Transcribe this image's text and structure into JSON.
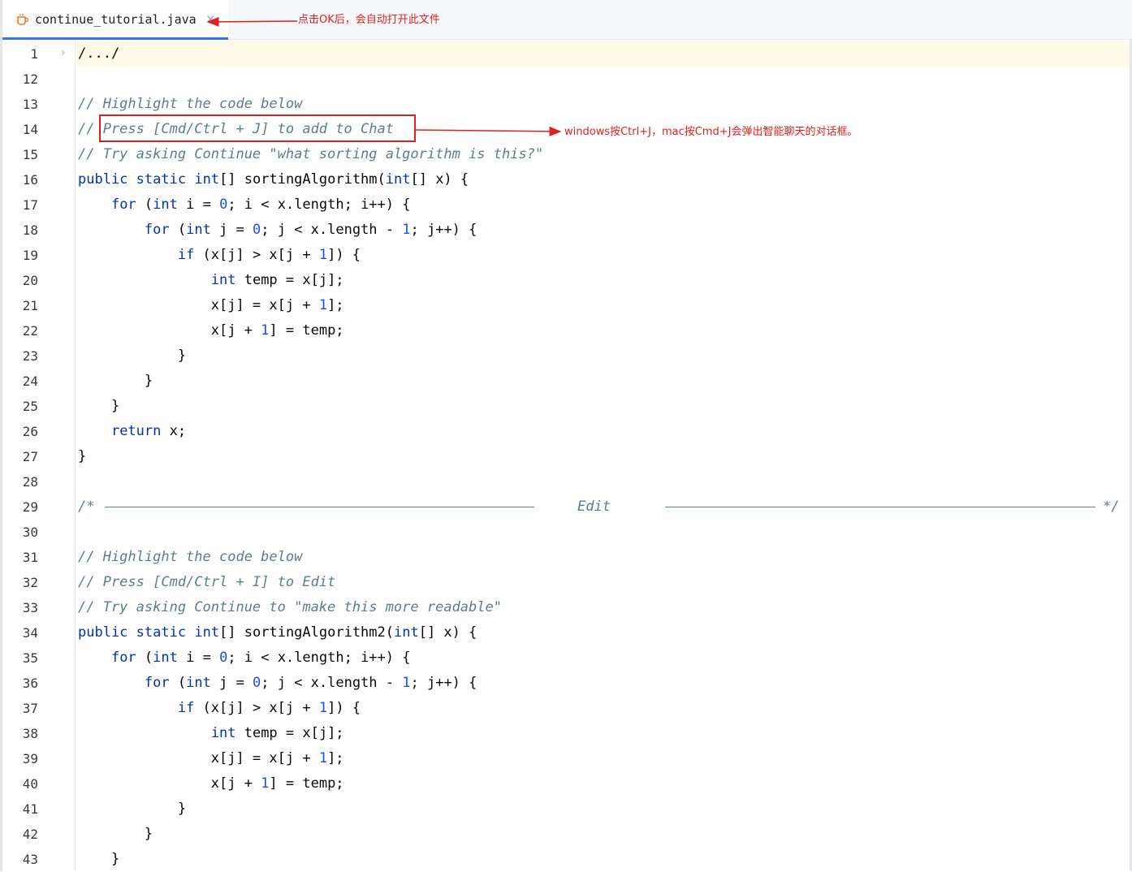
{
  "tab": {
    "file_name": "continue_tutorial.java",
    "icon": "java-file-icon",
    "close_glyph": "×"
  },
  "annotations": {
    "tab_note": "点击OK后，会自动打开此文件",
    "chat_note": "windows按Ctrl+J，mac按Cmd+J会弹出智能聊天的对话框。"
  },
  "colors": {
    "accent": "#3574f0",
    "annotation_red": "#e02020",
    "comment": "#5a7f87",
    "keyword": "#0033b3",
    "number": "#1750eb"
  },
  "editor": {
    "lines": [
      {
        "n": "1",
        "fold": "›",
        "text": "/.../",
        "kind": "folded"
      },
      {
        "n": "12",
        "text": ""
      },
      {
        "n": "13",
        "text": "// Highlight the code below",
        "kind": "comment"
      },
      {
        "n": "14",
        "text": "// Press [Cmd/Ctrl + J] to add to Chat",
        "kind": "comment"
      },
      {
        "n": "15",
        "text": "// Try asking Continue \"what sorting algorithm is this?\"",
        "kind": "comment"
      },
      {
        "n": "16",
        "text": "public static int[] sortingAlgorithm(int[] x) {"
      },
      {
        "n": "17",
        "text": "    for (int i = 0; i < x.length; i++) {"
      },
      {
        "n": "18",
        "text": "        for (int j = 0; j < x.length - 1; j++) {"
      },
      {
        "n": "19",
        "text": "            if (x[j] > x[j + 1]) {"
      },
      {
        "n": "20",
        "text": "                int temp = x[j];"
      },
      {
        "n": "21",
        "text": "                x[j] = x[j + 1];"
      },
      {
        "n": "22",
        "text": "                x[j + 1] = temp;"
      },
      {
        "n": "23",
        "text": "            }"
      },
      {
        "n": "24",
        "text": "        }"
      },
      {
        "n": "25",
        "text": "    }"
      },
      {
        "n": "26",
        "text": "    return x;"
      },
      {
        "n": "27",
        "text": "}"
      },
      {
        "n": "28",
        "text": ""
      },
      {
        "n": "29",
        "text": "",
        "kind": "separator",
        "sep_start": "/*",
        "sep_label": "Edit",
        "sep_end": "*/"
      },
      {
        "n": "30",
        "text": ""
      },
      {
        "n": "31",
        "text": "// Highlight the code below",
        "kind": "comment"
      },
      {
        "n": "32",
        "text": "// Press [Cmd/Ctrl + I] to Edit",
        "kind": "comment"
      },
      {
        "n": "33",
        "text": "// Try asking Continue to \"make this more readable\"",
        "kind": "comment"
      },
      {
        "n": "34",
        "text": "public static int[] sortingAlgorithm2(int[] x) {"
      },
      {
        "n": "35",
        "text": "    for (int i = 0; i < x.length; i++) {"
      },
      {
        "n": "36",
        "text": "        for (int j = 0; j < x.length - 1; j++) {"
      },
      {
        "n": "37",
        "text": "            if (x[j] > x[j + 1]) {"
      },
      {
        "n": "38",
        "text": "                int temp = x[j];"
      },
      {
        "n": "39",
        "text": "                x[j] = x[j + 1];"
      },
      {
        "n": "40",
        "text": "                x[j + 1] = temp;"
      },
      {
        "n": "41",
        "text": "            }"
      },
      {
        "n": "42",
        "text": "        }"
      },
      {
        "n": "43",
        "text": "    }"
      }
    ]
  }
}
